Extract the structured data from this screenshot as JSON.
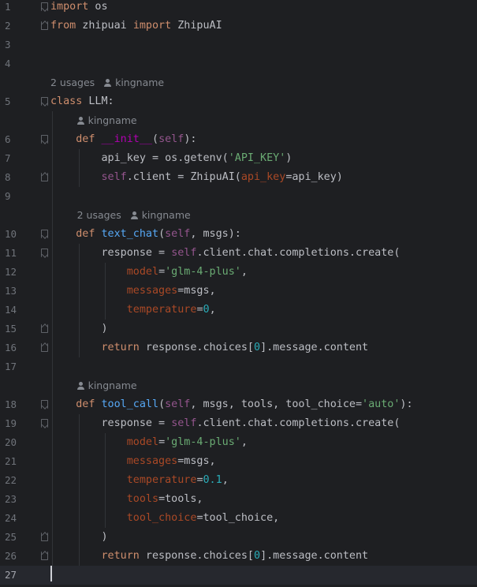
{
  "editor": {
    "language": "python",
    "theme": "dark",
    "lines": [
      {
        "n": "1",
        "fold": "start",
        "tokens": [
          {
            "t": "import",
            "c": "k"
          },
          {
            "t": " os"
          }
        ]
      },
      {
        "n": "2",
        "fold": "end",
        "tokens": [
          {
            "t": "from",
            "c": "k"
          },
          {
            "t": " zhipuai "
          },
          {
            "t": "import",
            "c": "k"
          },
          {
            "t": " ZhipuAI"
          }
        ]
      },
      {
        "n": "3",
        "tokens": []
      },
      {
        "n": "4",
        "tokens": []
      },
      {
        "hint": {
          "indent": 0,
          "usages": "2 usages",
          "author": "kingname"
        }
      },
      {
        "n": "5",
        "fold": "start",
        "tokens": [
          {
            "t": "class",
            "c": "k"
          },
          {
            "t": " LLM:"
          }
        ]
      },
      {
        "hint": {
          "indent": 4,
          "author": "kingname"
        }
      },
      {
        "n": "6",
        "fold": "start",
        "tokens": [
          {
            "t": "    "
          },
          {
            "t": "def",
            "c": "k"
          },
          {
            "t": " "
          },
          {
            "t": "__init__",
            "c": "dn"
          },
          {
            "t": "("
          },
          {
            "t": "self",
            "c": "self"
          },
          {
            "t": "):"
          }
        ]
      },
      {
        "n": "7",
        "tokens": [
          {
            "t": "        api_key = os.getenv("
          },
          {
            "t": "'API_KEY'",
            "c": "s"
          },
          {
            "t": ")"
          }
        ]
      },
      {
        "n": "8",
        "fold": "end",
        "tokens": [
          {
            "t": "        "
          },
          {
            "t": "self",
            "c": "self"
          },
          {
            "t": ".client = ZhipuAI("
          },
          {
            "t": "api_key",
            "c": "pm"
          },
          {
            "t": "=api_key)"
          }
        ]
      },
      {
        "n": "9",
        "tokens": []
      },
      {
        "hint": {
          "indent": 4,
          "usages": "2 usages",
          "author": "kingname"
        }
      },
      {
        "n": "10",
        "fold": "start",
        "tokens": [
          {
            "t": "    "
          },
          {
            "t": "def",
            "c": "k"
          },
          {
            "t": " "
          },
          {
            "t": "text_chat",
            "c": "fn"
          },
          {
            "t": "("
          },
          {
            "t": "self",
            "c": "self"
          },
          {
            "t": ", msgs):"
          }
        ]
      },
      {
        "n": "11",
        "fold": "start",
        "tokens": [
          {
            "t": "        response = "
          },
          {
            "t": "self",
            "c": "self"
          },
          {
            "t": ".client.chat.completions.create("
          }
        ]
      },
      {
        "n": "12",
        "tokens": [
          {
            "t": "            "
          },
          {
            "t": "model",
            "c": "pm"
          },
          {
            "t": "="
          },
          {
            "t": "'glm-4-plus'",
            "c": "s"
          },
          {
            "t": ","
          }
        ]
      },
      {
        "n": "13",
        "tokens": [
          {
            "t": "            "
          },
          {
            "t": "messages",
            "c": "pm"
          },
          {
            "t": "=msgs,"
          }
        ]
      },
      {
        "n": "14",
        "tokens": [
          {
            "t": "            "
          },
          {
            "t": "temperature",
            "c": "pm"
          },
          {
            "t": "="
          },
          {
            "t": "0",
            "c": "n"
          },
          {
            "t": ","
          }
        ]
      },
      {
        "n": "15",
        "fold": "end",
        "tokens": [
          {
            "t": "        )"
          }
        ]
      },
      {
        "n": "16",
        "fold": "end",
        "tokens": [
          {
            "t": "        "
          },
          {
            "t": "return",
            "c": "k"
          },
          {
            "t": " response.choices["
          },
          {
            "t": "0",
            "c": "n"
          },
          {
            "t": "].message.content"
          }
        ]
      },
      {
        "n": "17",
        "tokens": []
      },
      {
        "hint": {
          "indent": 4,
          "author": "kingname"
        }
      },
      {
        "n": "18",
        "fold": "start",
        "tokens": [
          {
            "t": "    "
          },
          {
            "t": "def",
            "c": "k"
          },
          {
            "t": " "
          },
          {
            "t": "tool_call",
            "c": "fn"
          },
          {
            "t": "("
          },
          {
            "t": "self",
            "c": "self"
          },
          {
            "t": ", msgs, tools, tool_choice="
          },
          {
            "t": "'auto'",
            "c": "s"
          },
          {
            "t": "):"
          }
        ]
      },
      {
        "n": "19",
        "fold": "start",
        "tokens": [
          {
            "t": "        response = "
          },
          {
            "t": "self",
            "c": "self"
          },
          {
            "t": ".client.chat.completions.create("
          }
        ]
      },
      {
        "n": "20",
        "tokens": [
          {
            "t": "            "
          },
          {
            "t": "model",
            "c": "pm"
          },
          {
            "t": "="
          },
          {
            "t": "'glm-4-plus'",
            "c": "s"
          },
          {
            "t": ","
          }
        ]
      },
      {
        "n": "21",
        "tokens": [
          {
            "t": "            "
          },
          {
            "t": "messages",
            "c": "pm"
          },
          {
            "t": "=msgs,"
          }
        ]
      },
      {
        "n": "22",
        "tokens": [
          {
            "t": "            "
          },
          {
            "t": "temperature",
            "c": "pm"
          },
          {
            "t": "="
          },
          {
            "t": "0.1",
            "c": "n"
          },
          {
            "t": ","
          }
        ]
      },
      {
        "n": "23",
        "tokens": [
          {
            "t": "            "
          },
          {
            "t": "tools",
            "c": "pm"
          },
          {
            "t": "=tools,"
          }
        ]
      },
      {
        "n": "24",
        "tokens": [
          {
            "t": "            "
          },
          {
            "t": "tool_choice",
            "c": "pm"
          },
          {
            "t": "=tool_choice,"
          }
        ]
      },
      {
        "n": "25",
        "fold": "end",
        "tokens": [
          {
            "t": "        )"
          }
        ]
      },
      {
        "n": "26",
        "fold": "end",
        "tokens": [
          {
            "t": "        "
          },
          {
            "t": "return",
            "c": "k"
          },
          {
            "t": " response.choices["
          },
          {
            "t": "0",
            "c": "n"
          },
          {
            "t": "].message.content"
          }
        ]
      },
      {
        "n": "27",
        "current": true,
        "tokens": []
      }
    ],
    "colors": {
      "background": "#1e1f22",
      "keyword": "#cf8e6d",
      "string": "#6aab73",
      "number": "#2aacb8",
      "self": "#94558d",
      "parameter": "#aa4926",
      "function": "#56a8f5",
      "dunder": "#b200b2",
      "hint": "#868a91",
      "line_number": "#6f737a"
    }
  }
}
